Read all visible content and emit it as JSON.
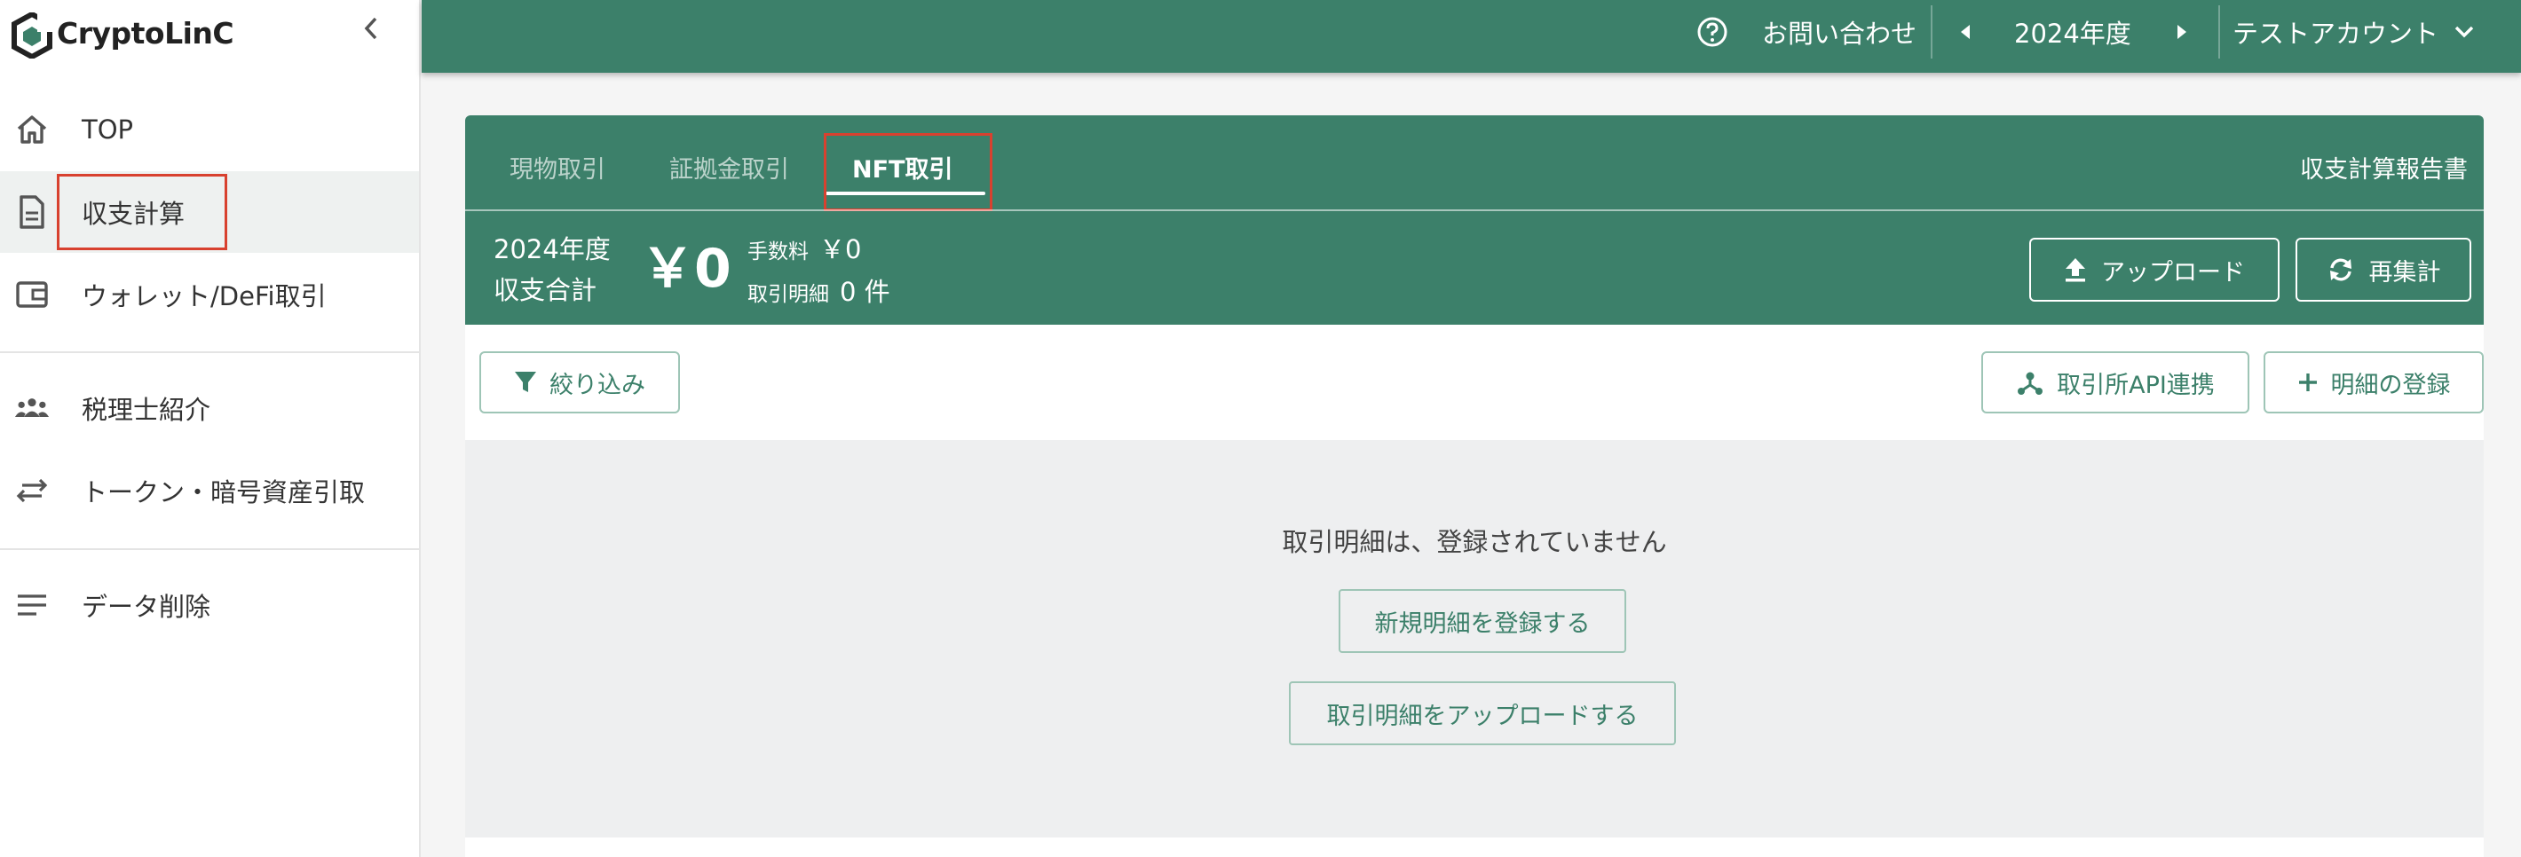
{
  "app": {
    "logo_text": "CryptoLinC"
  },
  "sidebar": {
    "items": [
      {
        "label": "TOP",
        "icon": "home-icon"
      },
      {
        "label": "収支計算",
        "icon": "document-icon"
      },
      {
        "label": "ウォレット/DeFi取引",
        "icon": "wallet-icon"
      },
      {
        "label": "税理士紹介",
        "icon": "people-icon"
      },
      {
        "label": "トークン・暗号資産引取",
        "icon": "swap-icon"
      },
      {
        "label": "データ削除",
        "icon": "list-icon"
      }
    ],
    "active_index": 1
  },
  "topbar": {
    "contact_label": "お問い合わせ",
    "year_label": "2024年度",
    "account_label": "テストアカウント"
  },
  "tabs": [
    {
      "label": "現物取引"
    },
    {
      "label": "証拠金取引"
    },
    {
      "label": "NFT取引"
    }
  ],
  "active_tab_index": 2,
  "report_link": "収支計算報告書",
  "summary": {
    "year": "2024年度",
    "total_label": "収支合計",
    "total_value": "￥0",
    "fee_label": "手数料",
    "fee_value": "￥0",
    "count_label": "取引明細",
    "count_value": "0 件"
  },
  "buttons": {
    "upload": "アップロード",
    "recalc": "再集計",
    "filter": "絞り込み",
    "api_link": "取引所API連携",
    "add_entry": "明細の登録",
    "new_entry": "新規明細を登録する",
    "upload_entries": "取引明細をアップロードする"
  },
  "empty_message": "取引明細は、登録されていません",
  "colors": {
    "brand": "#3c806a",
    "highlight": "#d8412f"
  }
}
